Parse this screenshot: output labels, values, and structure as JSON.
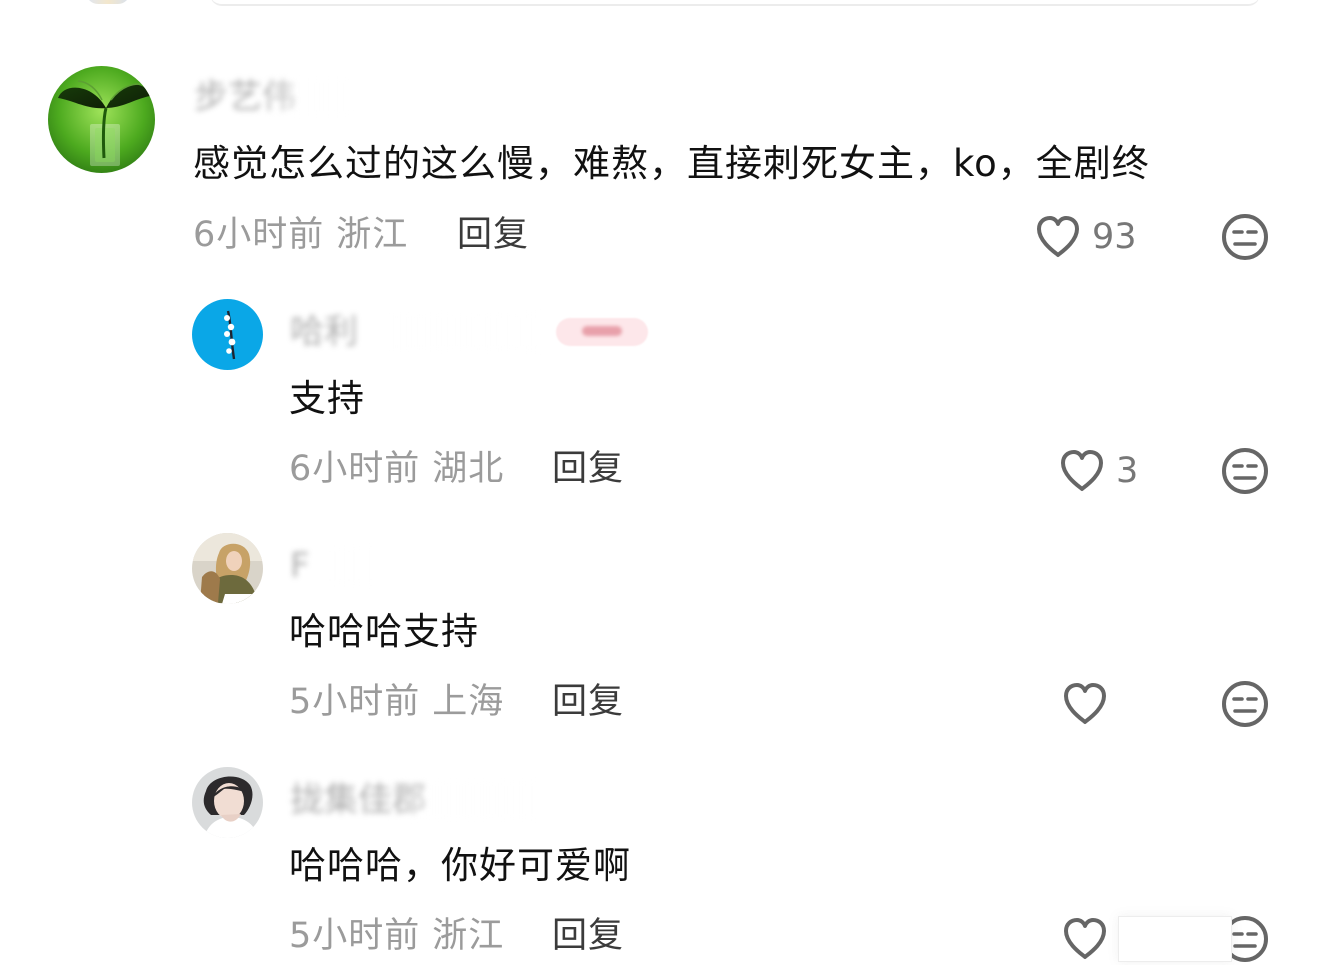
{
  "comments": [
    {
      "username": "步艺伟",
      "content": "感觉怎么过的这么慢，难熬，直接刺死女主，ko，全剧终",
      "time": "6小时前",
      "location": "浙江",
      "reply_label": "回复",
      "likes": "93",
      "avatar_icon": "plant-leaf-avatar"
    }
  ],
  "replies": [
    {
      "username": "哈利",
      "content": "支持",
      "time": "6小时前",
      "location": "湖北",
      "reply_label": "回复",
      "likes": "3",
      "avatar_icon": "blue-sky-flower-avatar"
    },
    {
      "username": "F",
      "content": "哈哈哈支持",
      "time": "5小时前",
      "location": "上海",
      "reply_label": "回复",
      "likes": "",
      "avatar_icon": "woman-photo-avatar"
    },
    {
      "username": "拢集佳郡",
      "content": "哈哈哈，你好可爱啊",
      "time": "5小时前",
      "location": "浙江",
      "reply_label": "回复",
      "likes": "",
      "avatar_icon": "portrait-avatar"
    }
  ],
  "icons": {
    "like": "heart-icon",
    "dislike": "neutral-face-icon"
  },
  "colors": {
    "text_primary": "#111111",
    "text_secondary": "#9b9b9b",
    "reply_text": "#3b3b3b",
    "icon": "#666666"
  }
}
